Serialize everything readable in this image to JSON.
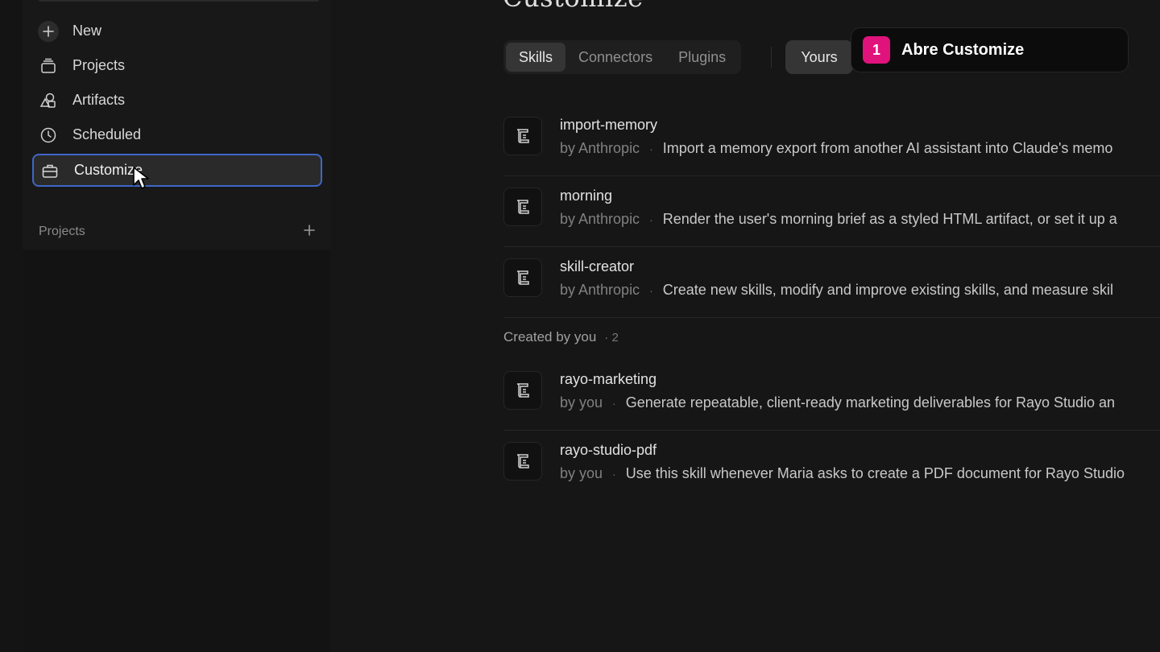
{
  "sidebar": {
    "items": [
      {
        "label": "New",
        "icon": "plus-icon"
      },
      {
        "label": "Projects",
        "icon": "stack-icon"
      },
      {
        "label": "Artifacts",
        "icon": "shapes-icon"
      },
      {
        "label": "Scheduled",
        "icon": "clock-icon"
      },
      {
        "label": "Customize",
        "icon": "briefcase-icon",
        "active": true
      }
    ],
    "projects_header": "Projects"
  },
  "main": {
    "title": "Customize",
    "tabs": [
      {
        "label": "Skills",
        "active": true
      },
      {
        "label": "Connectors"
      },
      {
        "label": "Plugins"
      }
    ],
    "filter": "Yours",
    "skills": [
      {
        "name": "import-memory",
        "author": "by Anthropic",
        "description": "Import a memory export from another AI assistant into Claude's memo"
      },
      {
        "name": "morning",
        "author": "by Anthropic",
        "description": "Render the user's morning brief as a styled HTML artifact, or set it up a"
      },
      {
        "name": "skill-creator",
        "author": "by Anthropic",
        "description": "Create new skills, modify and improve existing skills, and measure skil"
      }
    ],
    "created_section": {
      "label": "Created by you",
      "count": "· 2"
    },
    "my_skills": [
      {
        "name": "rayo-marketing",
        "author": "by you",
        "description": "Generate repeatable, client-ready marketing deliverables for Rayo Studio an"
      },
      {
        "name": "rayo-studio-pdf",
        "author": "by you",
        "description": "Use this skill whenever Maria asks to create a PDF document for Rayo Studio"
      }
    ]
  },
  "callout": {
    "step": "1",
    "text": "Abre Customize",
    "color": "#e0137c"
  },
  "colors": {
    "active_border": "#3f66c6",
    "background": "#161616"
  }
}
